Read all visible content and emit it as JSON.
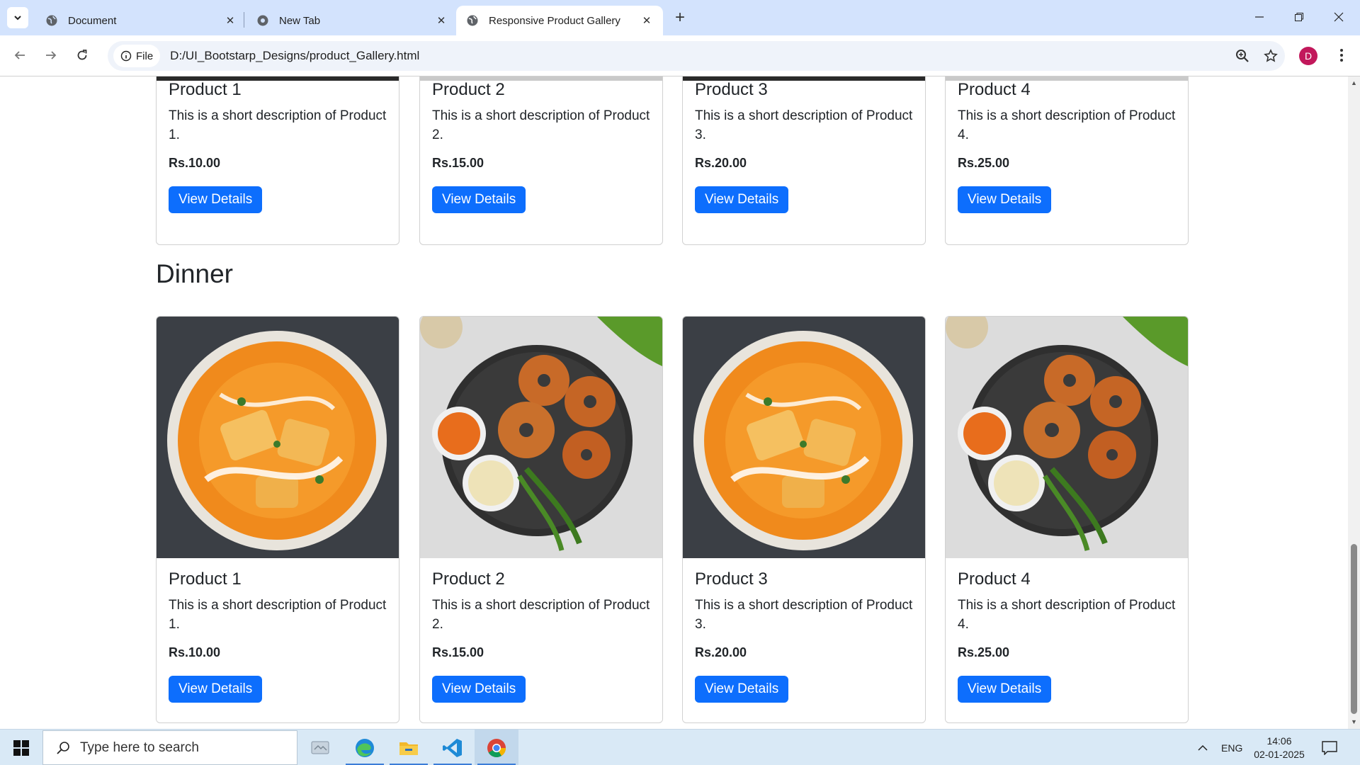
{
  "browser": {
    "tabs": [
      {
        "title": "Document"
      },
      {
        "title": "New Tab"
      },
      {
        "title": "Responsive Product Gallery"
      }
    ],
    "chip_label": "File",
    "url": "D:/UI_Bootstarp_Designs/product_Gallery.html",
    "profile_initial": "D"
  },
  "page": {
    "section_heading": "Dinner",
    "button_label": "View Details",
    "previous_row": [
      {
        "name": "Product 1",
        "description": "This is a short description of Product 1.",
        "price": "Rs.10.00"
      },
      {
        "name": "Product 2",
        "description": "This is a short description of Product 2.",
        "price": "Rs.15.00"
      },
      {
        "name": "Product 3",
        "description": "This is a short description of Product 3.",
        "price": "Rs.20.00"
      },
      {
        "name": "Product 4",
        "description": "This is a short description of Product 4.",
        "price": "Rs.25.00"
      }
    ],
    "dinner": [
      {
        "name": "Product 1",
        "description": "This is a short description of Product 1.",
        "price": "Rs.10.00",
        "image": "paneer-curry"
      },
      {
        "name": "Product 2",
        "description": "This is a short description of Product 2.",
        "price": "Rs.15.00",
        "image": "medu-vada"
      },
      {
        "name": "Product 3",
        "description": "This is a short description of Product 3.",
        "price": "Rs.20.00",
        "image": "paneer-curry"
      },
      {
        "name": "Product 4",
        "description": "This is a short description of Product 4.",
        "price": "Rs.25.00",
        "image": "medu-vada"
      }
    ]
  },
  "taskbar": {
    "search_placeholder": "Type here to search",
    "language": "ENG",
    "time": "14:06",
    "date": "02-01-2025"
  },
  "colors": {
    "primary_button": "#0d6efd",
    "tab_strip": "#d3e3fd",
    "taskbar": "#d9e9f6"
  }
}
